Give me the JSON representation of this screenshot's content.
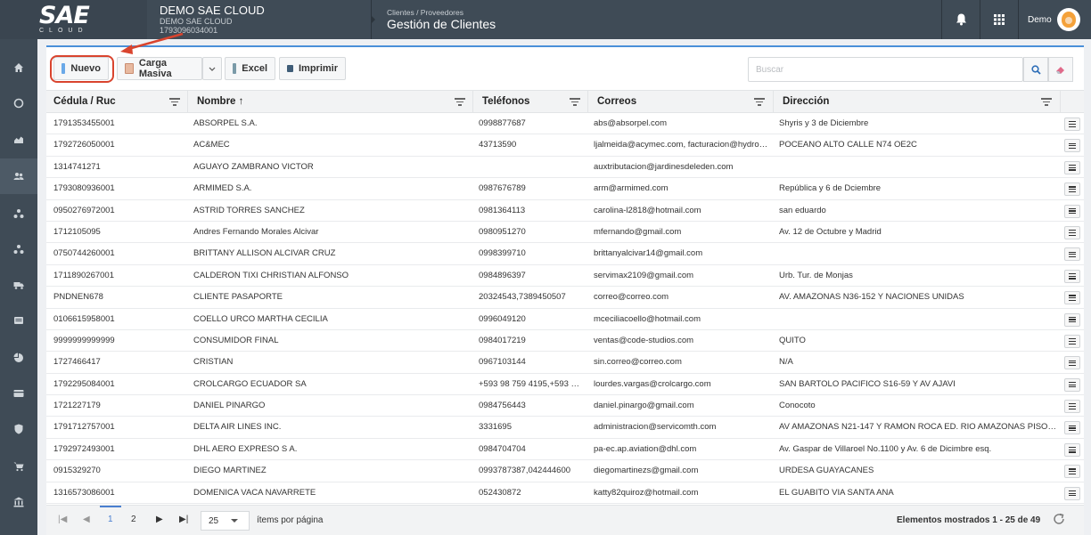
{
  "header": {
    "logo_text": "SAE",
    "logo_sub": "CLOUD",
    "company_name": "DEMO SAE CLOUD",
    "company_sub": "DEMO SAE CLOUD",
    "company_ruc": "1793096034001",
    "breadcrumb": "Clientes / Proveedores",
    "page_title": "Gestión de Clientes",
    "user_name": "Demo",
    "icons": [
      "bell-icon",
      "apps-grid-icon"
    ]
  },
  "sidebar": {
    "items": [
      "home-icon",
      "circle-icon",
      "chart-icon",
      "users-icon",
      "share-icon",
      "share-icon",
      "truck-icon",
      "list-icon",
      "pie-icon",
      "card-icon",
      "shield-icon",
      "cart-icon",
      "bank-icon"
    ],
    "active_index": 3
  },
  "toolbar": {
    "new_label": "Nuevo",
    "bulk_label": "Carga Masiva",
    "excel_label": "Excel",
    "print_label": "Imprimir",
    "search_placeholder": "Buscar"
  },
  "table": {
    "columns": [
      "Cédula / Ruc",
      "Nombre ↑",
      "Teléfonos",
      "Correos",
      "Dirección"
    ],
    "rows": [
      [
        "1791353455001",
        "ABSORPEL S.A.",
        "0998877687",
        "abs@absorpel.com",
        "Shyris y 3 de Diciembre"
      ],
      [
        "1792726050001",
        "AC&MEC",
        "43713590",
        "ljalmeida@acymec.com, facturacion@hydroc...",
        "POCEANO ALTO CALLE N74 OE2C"
      ],
      [
        "1314741271",
        "AGUAYO ZAMBRANO VICTOR",
        "",
        "auxtributacion@jardinesdeleden.com",
        ""
      ],
      [
        "1793080936001",
        "ARMIMED S.A.",
        "0987676789",
        "arm@armimed.com",
        "República y 6 de Dciembre"
      ],
      [
        "0950276972001",
        "ASTRID TORRES SANCHEZ",
        "0981364113",
        "carolina-l2818@hotmail.com",
        "san eduardo"
      ],
      [
        "1712105095",
        "Andres Fernando Morales Alcivar",
        "0980951270",
        "mfernando@gmail.com",
        "Av. 12 de Octubre y Madrid"
      ],
      [
        "0750744260001",
        "BRITTANY ALLISON ALCIVAR CRUZ",
        "0998399710",
        "brittanyalcivar14@gmail.com",
        ""
      ],
      [
        "1711890267001",
        "CALDERON TIXI CHRISTIAN ALFONSO",
        "0984896397",
        "servimax2109@gmail.com",
        "Urb. Tur. de Monjas"
      ],
      [
        "PNDNEN678",
        "CLIENTE PASAPORTE",
        "20324543,7389450507",
        "correo@correo.com",
        "AV. AMAZONAS N36-152 Y NACIONES UNIDAS"
      ],
      [
        "0106615958001",
        "COELLO URCO MARTHA CECILIA",
        "0996049120",
        "mceciliacoello@hotmail.com",
        ""
      ],
      [
        "9999999999999",
        "CONSUMIDOR FINAL",
        "0984017219",
        "ventas@code-studios.com",
        "QUITO"
      ],
      [
        "1727466417",
        "CRISTIAN",
        "0967103144",
        "sin.correo@correo.com",
        "N/A"
      ],
      [
        "1792295084001",
        "CROLCARGO ECUADOR SA",
        "+593 98 759 4195,+593 2 ...",
        "lourdes.vargas@crolcargo.com",
        "SAN BARTOLO PACIFICO S16-59 Y AV AJAVI"
      ],
      [
        "1721227179",
        "DANIEL PINARGO",
        "0984756443",
        "daniel.pinargo@gmail.com",
        "Conocoto"
      ],
      [
        "1791712757001",
        "DELTA AIR LINES INC.",
        "3331695",
        "administracion@servicomth.com",
        "AV AMAZONAS N21-147 Y RAMON ROCA ED. RIO AMAZONAS PISO 10 O..."
      ],
      [
        "1792972493001",
        "DHL AERO EXPRESO S A.",
        "0984704704",
        "pa-ec.ap.aviation@dhl.com",
        "Av. Gaspar de Villaroel No.1100 y Av. 6 de Dicimbre esq."
      ],
      [
        "0915329270",
        "DIEGO MARTINEZ",
        "0993787387,042444600",
        "diegomartinezs@gmail.com",
        "URDESA GUAYACANES"
      ],
      [
        "1316573086001",
        "DOMENICA VACA NAVARRETE",
        "052430872",
        "katty82quiroz@hotmail.com",
        "EL GUABITO VIA SANTA ANA"
      ]
    ]
  },
  "pager": {
    "first": "|◀",
    "prev": "◀",
    "pages": [
      "1",
      "2"
    ],
    "current_page": "1",
    "next": "▶",
    "last": "▶|",
    "page_size": "25",
    "items_per_page_label": "ítems por página",
    "shown_label": "Elementos mostrados 1 - 25 de 49"
  },
  "colors": {
    "topbar": "#3f4b56",
    "accent": "#4a90d9",
    "highlight": "#d9442e"
  }
}
